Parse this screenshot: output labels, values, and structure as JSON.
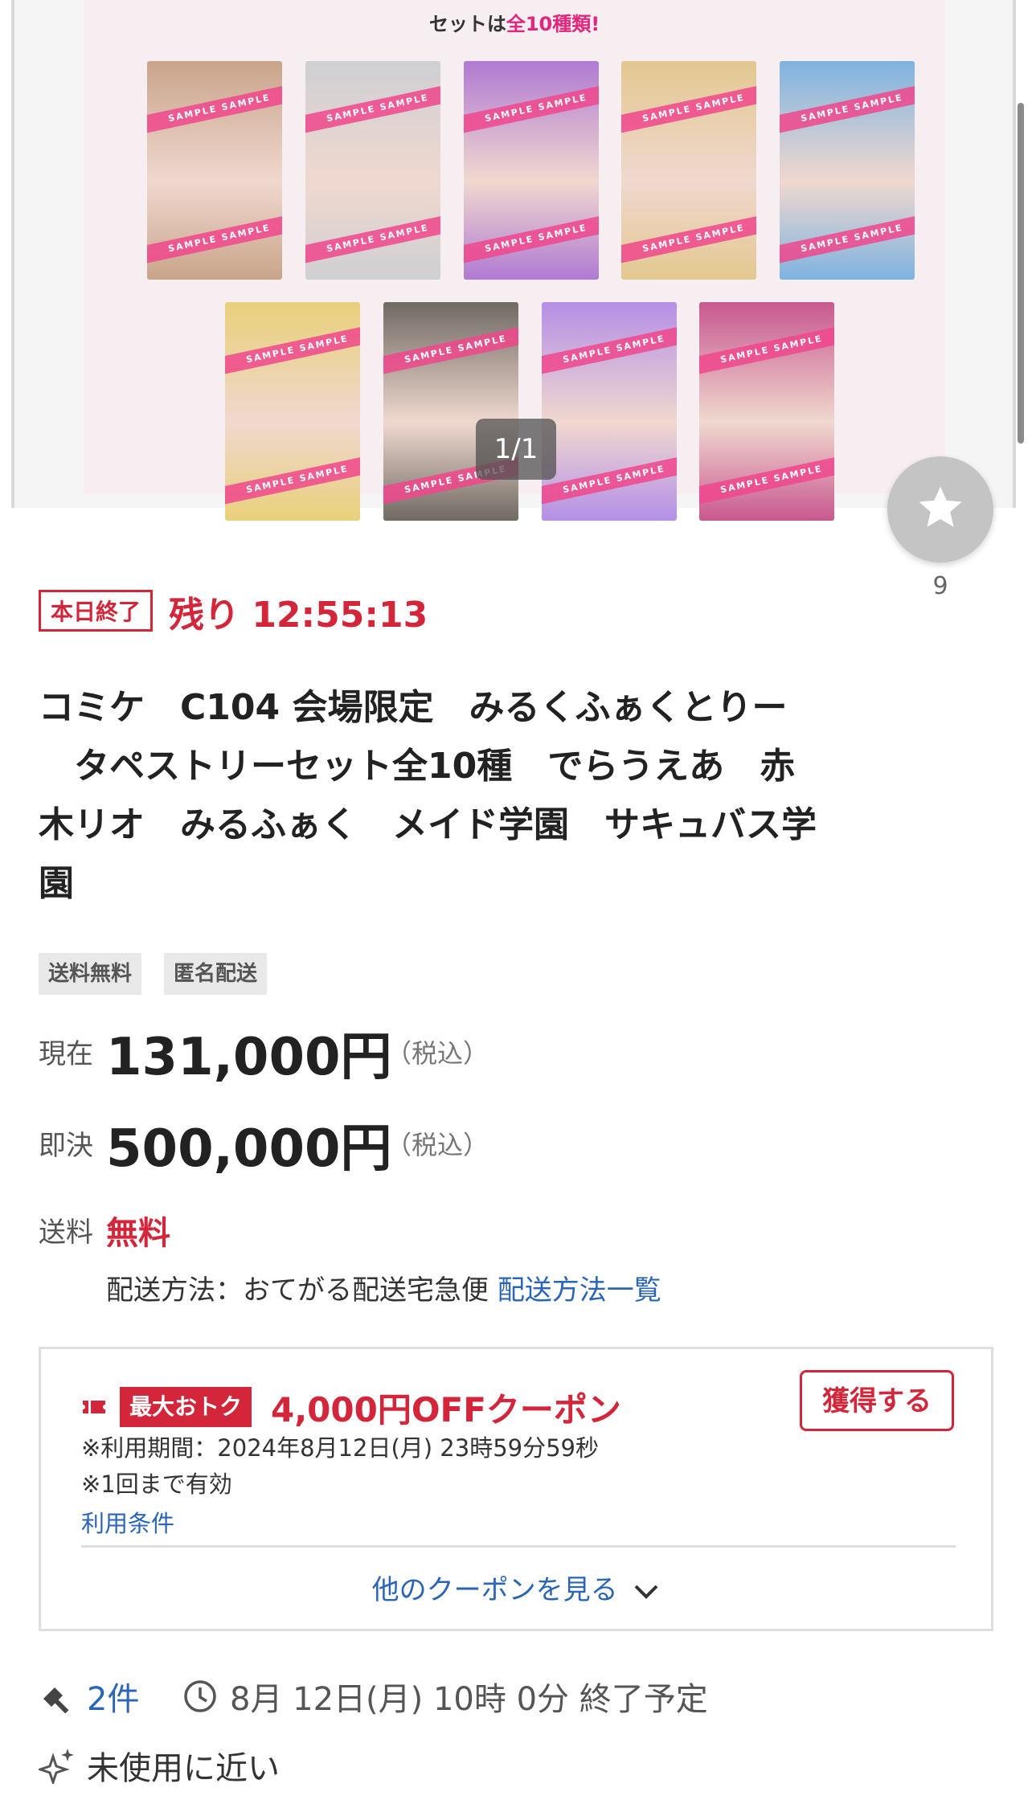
{
  "hero": {
    "caption_prefix": "セットは",
    "caption_accent": "全10種類!",
    "sample_text": "SAMPLE SAMPLE",
    "counter": "1/1",
    "cards_row1": [
      "#c9a48a",
      "#cfcfd3",
      "#b07ad2",
      "#e3c890",
      "#7fb3e0"
    ],
    "cards_row2": [
      "#e9d07a",
      "#6f6a63",
      "#b48fe6",
      "#c8588f"
    ]
  },
  "favorite": {
    "icon": "star-icon",
    "count": "9"
  },
  "auction": {
    "ending_badge": "本日終了",
    "remaining": "残り 12:55:13",
    "title": "コミケ　C104 会場限定　みるくふぁくとりー\n　タペストリーセット全10種　でらうえあ　赤\n木リオ　みるふぁく　メイド学園　サキュバス学\n園"
  },
  "tags": [
    "送料無料",
    "匿名配送"
  ],
  "price": {
    "current_label": "現在",
    "current_value": "131,000円",
    "buyout_label": "即決",
    "buyout_value": "500,000円",
    "tax_note": "（税込）"
  },
  "shipping": {
    "label": "送料",
    "value": "無料",
    "method_text": "配送方法：おてがる配送宅急便",
    "method_link": "配送方法一覧"
  },
  "coupon": {
    "badge": "最大おトク",
    "amount": "4,000円OFFクーポン",
    "get_button": "獲得する",
    "period": "※利用期間：2024年8月12日(月) 23時59分59秒",
    "limit": "※1回まで有効",
    "terms_link": "利用条件",
    "more_link": "他のクーポンを見る"
  },
  "meta": {
    "bids": "2件",
    "end_time": "8月 12日(月) 10時 0分 終了予定",
    "condition": "未使用に近い"
  },
  "colors": {
    "accent_red": "#d3263a",
    "link_blue": "#2a65b8"
  }
}
